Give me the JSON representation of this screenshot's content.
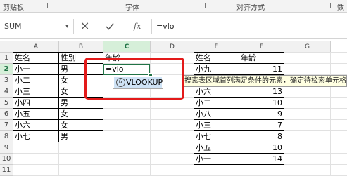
{
  "ribbon": {
    "groups": [
      "剪贴板",
      "字体",
      "对齐方式",
      "数"
    ]
  },
  "formula_bar": {
    "name_box": "SUM",
    "cancel_icon": "cancel-icon",
    "enter_icon": "check-icon",
    "fx_label": "fx",
    "formula": "=vlo"
  },
  "columns": [
    "A",
    "B",
    "C",
    "D",
    "E",
    "F",
    "G"
  ],
  "rows": [
    "1",
    "2",
    "3",
    "4",
    "5",
    "6",
    "7",
    "8",
    "9",
    "10",
    "11"
  ],
  "table_left": {
    "headers": [
      "姓名",
      "性别",
      "年龄"
    ],
    "rows": [
      [
        "小一",
        "男"
      ],
      [
        "小二",
        "女"
      ],
      [
        "小三",
        "女"
      ],
      [
        "小四",
        "男"
      ],
      [
        "小五",
        "女"
      ],
      [
        "小六",
        "女"
      ],
      [
        "小七",
        "男"
      ]
    ],
    "editing_cell": "=vlo"
  },
  "table_right": {
    "headers": [
      "姓名",
      "年龄"
    ],
    "rows": [
      [
        "小九",
        "11"
      ],
      [
        "",
        ""
      ],
      [
        "小六",
        "13"
      ],
      [
        "小二",
        "10"
      ],
      [
        "小八",
        "9"
      ],
      [
        "小三",
        "7"
      ],
      [
        "小七",
        "8"
      ],
      [
        "小五",
        "10"
      ],
      [
        "小一",
        "14"
      ]
    ]
  },
  "autocomplete": {
    "item": "VLOOKUP",
    "tooltip": "搜索表区域首列满足条件的元素，确定待检索单元格"
  },
  "colors": {
    "accent": "#217346",
    "annotation": "#e31a1a",
    "tooltip_bg": "#ffffe1"
  }
}
